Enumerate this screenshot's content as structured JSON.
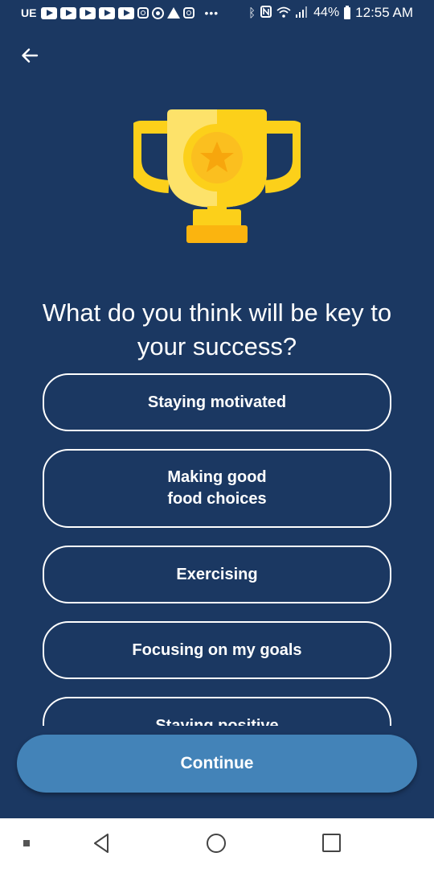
{
  "status_bar": {
    "carrier": "UE",
    "battery": "44%",
    "time": "12:55 AM"
  },
  "colors": {
    "background": "#1b3862",
    "continue_button": "#4383b8",
    "trophy_gold": "#fcd01a"
  },
  "question": "What do you think will be key to your success?",
  "options": [
    "Staying motivated",
    "Making good\nfood choices",
    "Exercising",
    "Focusing on my goals",
    "Staying positive"
  ],
  "continue_label": "Continue",
  "icons": {
    "back": "arrow-left-icon",
    "hero": "trophy-icon"
  }
}
